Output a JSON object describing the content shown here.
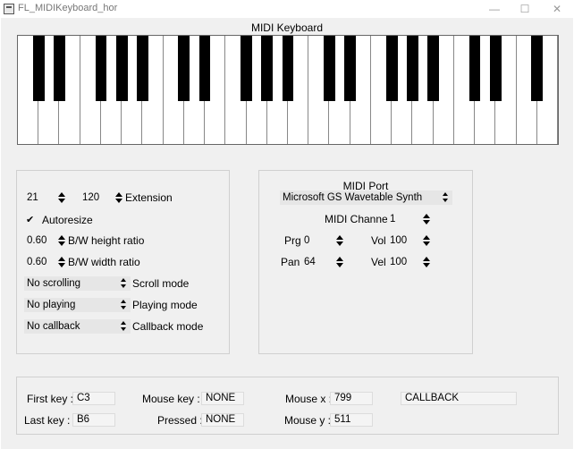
{
  "window": {
    "title": "FL_MIDIKeyboard_hor",
    "minimize_glyph": "—",
    "maximize_glyph": "☐",
    "close_glyph": "✕"
  },
  "keyboard": {
    "label": "MIDI Keyboard",
    "white_key_count": 26,
    "black_key_pattern": [
      1,
      1,
      0,
      1,
      1,
      1,
      0,
      1,
      1,
      0,
      1,
      1,
      1,
      0,
      1,
      1,
      0,
      1,
      1,
      1,
      0,
      1,
      1,
      0,
      1,
      0
    ]
  },
  "left_panel": {
    "low_key": "21",
    "high_key": "120",
    "extension_label": "Extension",
    "autoresize_check": "✔",
    "autoresize_label": "Autoresize",
    "bw_height_value": "0.60",
    "bw_height_label": "B/W height ratio",
    "bw_width_value": "0.60",
    "bw_width_label": "B/W width ratio",
    "scroll_mode_value": "No scrolling",
    "scroll_mode_label": "Scroll mode",
    "playing_mode_value": "No playing",
    "playing_mode_label": "Playing mode",
    "callback_mode_value": "No callback",
    "callback_mode_label": "Callback mode"
  },
  "right_panel": {
    "midi_port_label": "MIDI Port",
    "midi_port_value": "Microsoft GS Wavetable Synth",
    "midi_channel_label": "MIDI Channel",
    "midi_channel_value": "1",
    "prg_label": "Prg",
    "prg_value": "0",
    "vol_label": "Vol",
    "vol_value": "100",
    "pan_label": "Pan",
    "pan_value": "64",
    "vel_label": "Vel",
    "vel_value": "100"
  },
  "status": {
    "first_key_label": "First key :",
    "first_key_value": "C3",
    "last_key_label": "Last  key :",
    "last_key_value": "B6",
    "mouse_key_label": "Mouse  key :",
    "mouse_key_value": "NONE",
    "pressed_label": "Pressed :",
    "pressed_value": "NONE",
    "mouse_x_label": "Mouse x :",
    "mouse_x_value": "799",
    "mouse_y_label": "Mouse y :",
    "mouse_y_value": "511",
    "callback_value": "CALLBACK"
  }
}
